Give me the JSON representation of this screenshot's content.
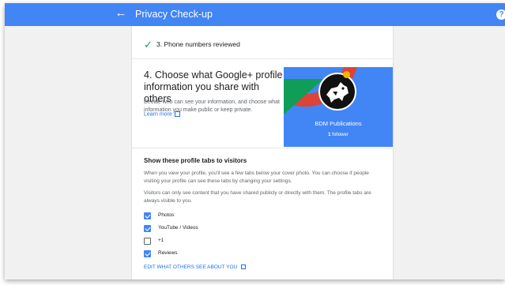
{
  "header": {
    "title": "Privacy Check-up",
    "back_icon": "arrow-back-icon",
    "help_icon": "help-icon",
    "help_glyph": "?",
    "color": "#4285f4"
  },
  "completed_step": {
    "icon": "check-icon",
    "label": "3. Phone numbers reviewed"
  },
  "section": {
    "heading": "4. Choose what Google+ profile information you share with others",
    "description": "Decide who can see your information, and choose what information you make public or keep private.",
    "learn_more": "Learn more"
  },
  "profile_card": {
    "name": "BDM Publications",
    "follower_count": "1",
    "follower_label": "follower",
    "colors": [
      "#db4437",
      "#0f9d58",
      "#f4b400",
      "#4285f4"
    ]
  },
  "tabs_section": {
    "heading": "Show these profile tabs to visitors",
    "paragraph1": "When you view your profile, you'll see a few tabs below your cover photo. You can choose if people visiting your profile can see these tabs by changing your settings.",
    "paragraph2": "Visitors can only see content that you have shared publicly or directly with them. The profile tabs are always visible to you.",
    "items": [
      {
        "label": "Photos",
        "checked": true
      },
      {
        "label": "YouTube / Videos",
        "checked": true
      },
      {
        "label": "+1",
        "checked": false
      },
      {
        "label": "Reviews",
        "checked": true
      }
    ],
    "edit_link": "EDIT WHAT OTHERS SEE ABOUT YOU"
  }
}
